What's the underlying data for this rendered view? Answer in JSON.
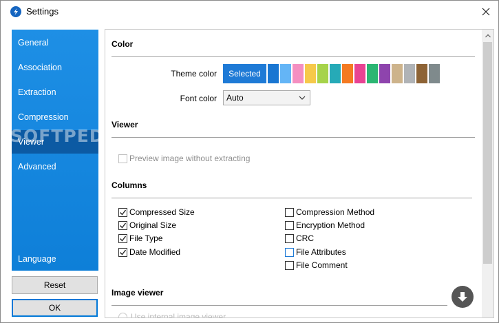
{
  "window": {
    "title": "Settings"
  },
  "sidebar": {
    "items": [
      {
        "label": "General"
      },
      {
        "label": "Association"
      },
      {
        "label": "Extraction"
      },
      {
        "label": "Compression"
      },
      {
        "label": "Viewer"
      },
      {
        "label": "Advanced"
      }
    ],
    "active_index": 4,
    "bottom_item": "Language",
    "watermark": "SOFTPEDIA"
  },
  "buttons": {
    "reset": "Reset",
    "ok": "OK"
  },
  "color_section": {
    "title": "Color",
    "theme_color_label": "Theme color",
    "selected_label": "Selected",
    "selected_color": "#1e7ad6",
    "swatches": [
      "#1976d2",
      "#64b5f6",
      "#f48fc1",
      "#f6c94a",
      "#a6d34a",
      "#26aab7",
      "#f47a22",
      "#e84393",
      "#2bb673",
      "#8e44ad",
      "#cdb38b",
      "#b0b3b6",
      "#8d6335",
      "#7f8a8c"
    ],
    "font_color_label": "Font color",
    "font_color_value": "Auto"
  },
  "viewer_section": {
    "title": "Viewer",
    "preview_label": "Preview image without extracting",
    "preview_checked": false
  },
  "columns_section": {
    "title": "Columns",
    "left": [
      {
        "label": "Compressed Size",
        "checked": true
      },
      {
        "label": "Original Size",
        "checked": true
      },
      {
        "label": "File Type",
        "checked": true
      },
      {
        "label": "Date Modified",
        "checked": true
      }
    ],
    "right": [
      {
        "label": "Compression Method",
        "checked": false
      },
      {
        "label": "Encryption Method",
        "checked": false
      },
      {
        "label": "CRC",
        "checked": false
      },
      {
        "label": "File Attributes",
        "checked": false
      },
      {
        "label": "File Comment",
        "checked": false
      }
    ]
  },
  "image_viewer_section": {
    "title": "Image viewer",
    "radio_label": "Use internal image viewer"
  },
  "icons": {
    "app": "app-logo-icon",
    "close": "close-icon",
    "dropdown": "chevron-down-icon",
    "scroll_down": "arrow-down-icon"
  }
}
